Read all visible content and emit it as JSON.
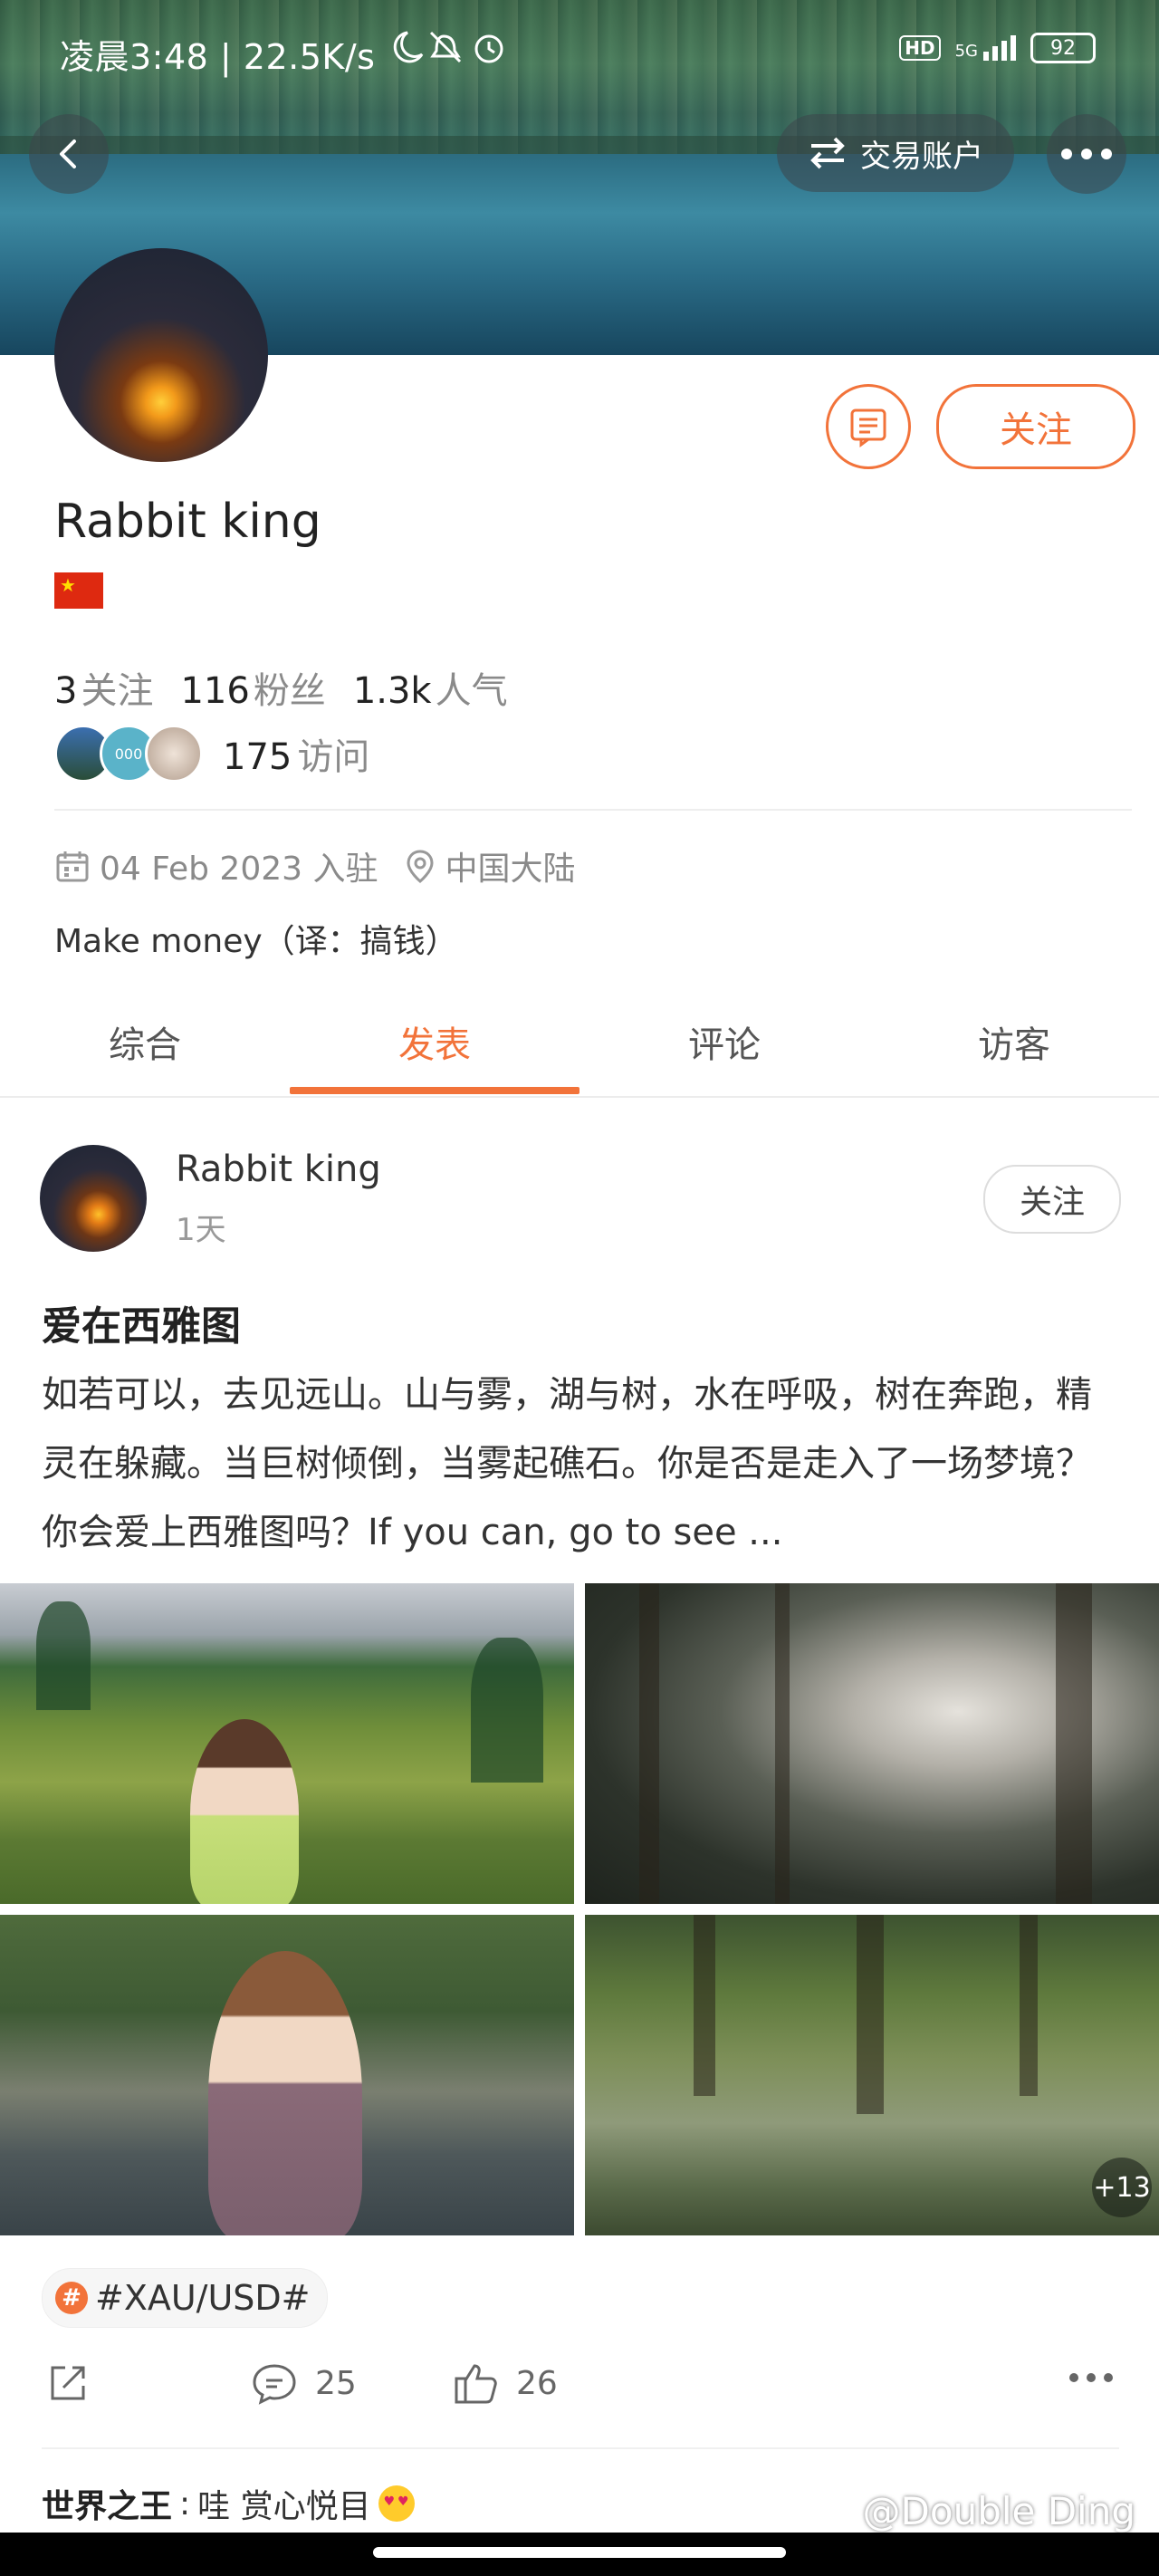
{
  "status_bar": {
    "left_text": "凌晨3:48 | 22.5K/s",
    "hd": "HD",
    "network": "5G",
    "battery": "92"
  },
  "header": {
    "trade_account_label": "交易账户"
  },
  "profile": {
    "name": "Rabbit king",
    "follow_label": "关注",
    "stats": [
      {
        "value": "3",
        "label": "关注"
      },
      {
        "value": "116",
        "label": "粉丝"
      },
      {
        "value": "1.3k",
        "label": "人气"
      }
    ],
    "visitor_avatar_text": "000",
    "visits_value": "175",
    "visits_label": "访问",
    "join_date": "04 Feb 2023 入驻",
    "location": "中国大陆",
    "bio": "Make money（译：搞钱）"
  },
  "tabs": [
    {
      "label": "综合"
    },
    {
      "label": "发表"
    },
    {
      "label": "评论"
    },
    {
      "label": "访客"
    }
  ],
  "active_tab": "发表",
  "post": {
    "author": "Rabbit king",
    "time": "1天",
    "follow_label": "关注",
    "title": "爱在西雅图",
    "body": "如若可以，去见远山。山与雾，湖与树，水在呼吸，树在奔跑，精灵在躲藏。当巨树倾倒，当雾起礁石。你是否是走入了一场梦境？你会爱上西雅图吗？If you can, go to see ...",
    "more_photos": "+13",
    "tag": "#XAU/USD#",
    "comments_count": "25",
    "likes_count": "26",
    "comment_preview": {
      "author": "世界之王",
      "separator": ":",
      "text": "哇 赏心悦目"
    }
  },
  "watermark": "@Double Ding",
  "colors": {
    "accent": "#f2733a"
  }
}
